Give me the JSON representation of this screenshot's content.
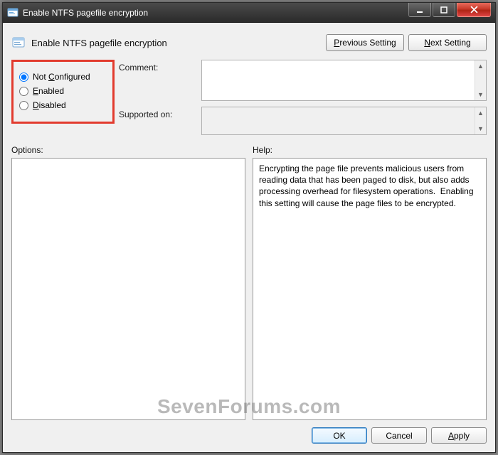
{
  "window": {
    "title": "Enable NTFS pagefile encryption"
  },
  "header": {
    "policy_title": "Enable NTFS pagefile encryption",
    "prev_button_pre": "",
    "prev_button_ul": "P",
    "prev_button_post": "revious Setting",
    "next_button_pre": "",
    "next_button_ul": "N",
    "next_button_post": "ext Setting"
  },
  "state": {
    "not_configured": {
      "ul": "C",
      "pre": "Not ",
      "post": "onfigured",
      "checked": true
    },
    "enabled": {
      "ul": "E",
      "pre": "",
      "post": "nabled",
      "checked": false
    },
    "disabled": {
      "ul": "D",
      "pre": "",
      "post": "isabled",
      "checked": false
    }
  },
  "labels": {
    "comment": "Comment:",
    "supported": "Supported on:",
    "options": "Options:",
    "help": "Help:"
  },
  "fields": {
    "comment_value": "",
    "supported_value": ""
  },
  "help_text": "Encrypting the page file prevents malicious users from reading data that has been paged to disk, but also adds processing overhead for filesystem operations.  Enabling this setting will cause the page files to be encrypted.",
  "footer": {
    "ok": "OK",
    "cancel": "Cancel",
    "apply_ul": "A",
    "apply_post": "pply"
  },
  "watermark": "SevenForums.com"
}
